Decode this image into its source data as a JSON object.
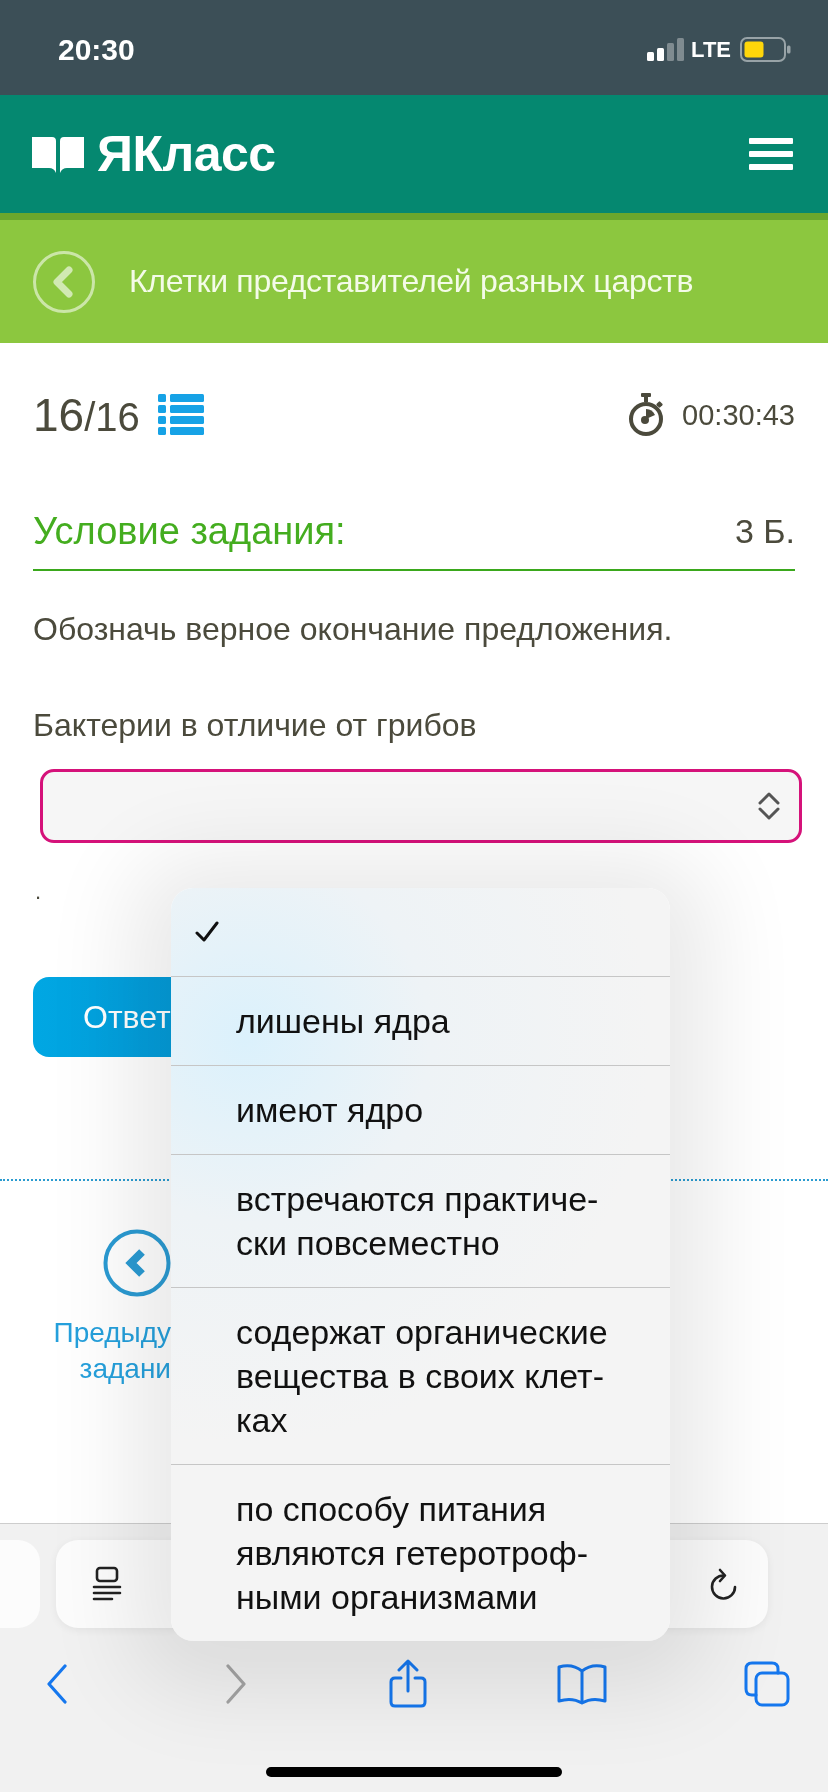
{
  "status_bar": {
    "time": "20:30",
    "network": "LTE"
  },
  "header": {
    "logo_text": "ЯКласс"
  },
  "topic_bar": {
    "title": "Клетки представителей разных царств"
  },
  "task": {
    "counter": {
      "current": "16",
      "total": "/16"
    },
    "timer": "00:30:43"
  },
  "condition": {
    "heading": "Условие задания:",
    "points": "3 Б.",
    "instruction": "Обозначь верное окончание предложения."
  },
  "question": {
    "stem": "Бактерии в отличие от грибов",
    "select": {
      "open": true,
      "options": [
        {
          "selected": true
        },
        {
          "lines": [
            "лишены ядра"
          ],
          "selected": false
        },
        {
          "lines": [
            "имеют ядро"
          ],
          "selected": false
        },
        {
          "lines": [
            "встречаются практиче-",
            "ски повсеместно"
          ],
          "selected": false
        },
        {
          "lines": [
            "содержат органические",
            "вещества в своих клет-",
            "ках"
          ],
          "selected": false
        },
        {
          "lines": [
            "по способу питания",
            "являются гетеротроф-",
            "ными организмами"
          ],
          "selected": false
        }
      ]
    },
    "after": "."
  },
  "answer_button": "Ответ",
  "previous_task": {
    "lines": [
      "Предыду",
      "задани"
    ]
  },
  "browser": {
    "toolbar": [
      {
        "kind": "back",
        "disabled": false
      },
      {
        "kind": "forward",
        "disabled": true
      },
      {
        "kind": "share",
        "disabled": false
      },
      {
        "kind": "bookmarks",
        "disabled": false
      },
      {
        "kind": "tabs",
        "disabled": false
      }
    ]
  }
}
